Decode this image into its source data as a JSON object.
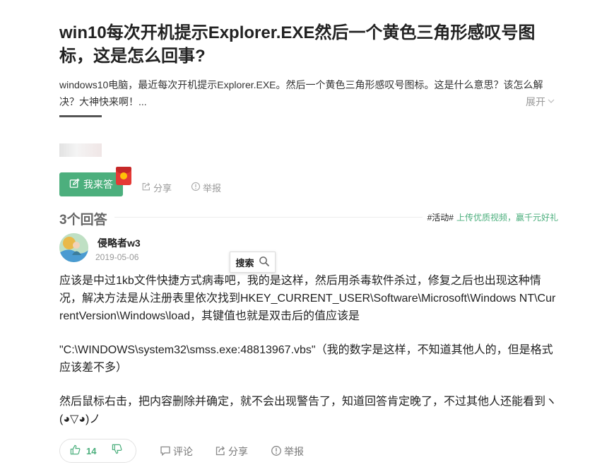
{
  "question": {
    "title": "win10每次开机提示Explorer.EXE然后一个黄色三角形感叹号图标，这是怎么回事?",
    "description": "windows10电脑，最近每次开机提示Explorer.EXE。然后一个黄色三角形感叹号图标。这是什么意思？该怎么解决？大神快来啊！...",
    "expand_label": "展开",
    "answer_button_label": "我来答",
    "share_label": "分享",
    "report_label": "举报"
  },
  "answers_header": {
    "count_label": "3个回答",
    "promo_tag": "#活动#",
    "promo_text": "上传优质视频，赢千元好礼"
  },
  "answer": {
    "author": "侵略者w3",
    "date": "2019-05-06",
    "paragraphs": [
      "应该是中过1kb文件快捷方式病毒吧，我的是这样，然后用杀毒软件杀过，修复之后也出现这种情况，解决方法是从注册表里依次找到HKEY_CURRENT_USER\\Software\\Microsoft\\Windows NT\\CurrentVersion\\Windows\\load，其键值也就是双击后的值应该是",
      "\"C:\\WINDOWS\\system32\\smss.exe:48813967.vbs\"（我的数字是这样，不知道其他人的，但是格式应该差不多）",
      "然后鼠标右击，把内容删除并确定，就不会出现警告了，知道回答肯定晚了，不过其他人还能看到ヽ(◕▽◕)ノ"
    ],
    "upvote_count": "14",
    "comment_label": "评论",
    "share_label": "分享",
    "report_label": "举报"
  },
  "search_popup": {
    "label": "搜索"
  },
  "colors": {
    "accent_green": "#4caf7d",
    "muted_gray": "#999999",
    "text_dark": "#222222"
  },
  "icons": [
    "chevron-down-icon",
    "edit-icon",
    "share-icon",
    "report-icon",
    "search-icon",
    "thumbs-up-icon",
    "thumbs-down-icon",
    "comment-icon",
    "red-packet-icon"
  ]
}
